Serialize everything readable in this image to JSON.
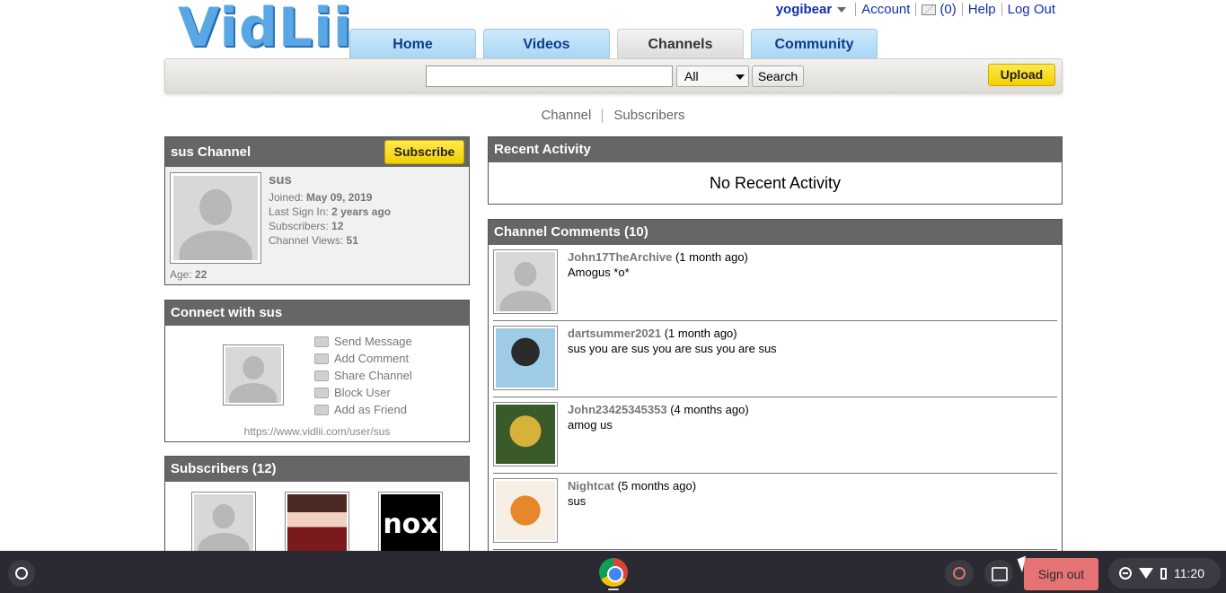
{
  "header": {
    "logo_text": "VidLii",
    "username": "yogibear",
    "account": "Account",
    "inbox_count": "(0)",
    "help": "Help",
    "logout": "Log Out"
  },
  "tabs": [
    {
      "label": "Home"
    },
    {
      "label": "Videos"
    },
    {
      "label": "Channels"
    },
    {
      "label": "Community"
    }
  ],
  "search": {
    "value": "",
    "scope": "All",
    "button": "Search",
    "upload": "Upload"
  },
  "subnav": {
    "channel": "Channel",
    "subscribers": "Subscribers"
  },
  "profile": {
    "title": "sus Channel",
    "subscribe": "Subscribe",
    "name": "sus",
    "joined_label": "Joined:",
    "joined": "May 09, 2019",
    "last_signin_label": "Last Sign In:",
    "last_signin": "2 years ago",
    "subscribers_label": "Subscribers:",
    "subscribers": "12",
    "views_label": "Channel Views:",
    "views": "51",
    "age_label": "Age:",
    "age": "22"
  },
  "connect": {
    "title": "Connect with sus",
    "actions": [
      "Send Message",
      "Add Comment",
      "Share Channel",
      "Block User",
      "Add as Friend"
    ],
    "url": "https://www.vidlii.com/user/sus"
  },
  "subscribers_box": {
    "title": "Subscribers (12)",
    "third_thumb_text": "nox"
  },
  "activity": {
    "title": "Recent Activity",
    "empty": "No Recent Activity"
  },
  "comments": {
    "title": "Channel Comments (10)",
    "items": [
      {
        "user": "John17TheArchive",
        "time": "(1 month ago)",
        "text": "Amogus *o*"
      },
      {
        "user": "dartsummer2021",
        "time": "(1 month ago)",
        "text": "sus you are sus you are sus you are sus"
      },
      {
        "user": "John23425345353",
        "time": "(4 months ago)",
        "text": "amog us"
      },
      {
        "user": "Nightcat",
        "time": "(5 months ago)",
        "text": "sus"
      }
    ]
  },
  "taskbar": {
    "signout": "Sign out",
    "time": "11:20"
  }
}
